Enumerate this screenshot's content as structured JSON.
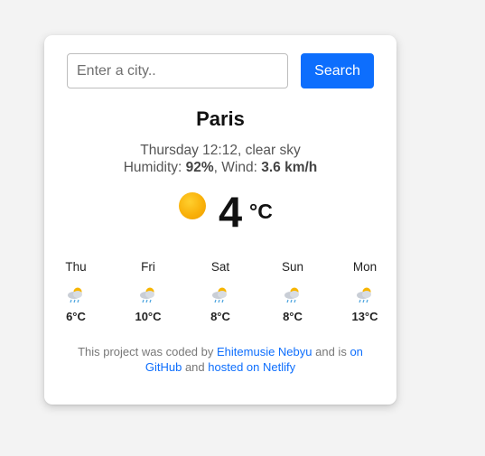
{
  "search": {
    "placeholder": "Enter a city..",
    "button_label": "Search"
  },
  "current": {
    "city": "Paris",
    "day_time": "Thursday 12:12",
    "description": "clear sky",
    "humidity_label": "Humidity:",
    "humidity_value": "92%",
    "wind_label": "Wind:",
    "wind_value": "3.6 km/h",
    "temperature": "4",
    "unit": "°C",
    "icon": "sun-icon"
  },
  "forecast": [
    {
      "day": "Thu",
      "temp": "6°C",
      "icon": "cloud-sun-rain-icon"
    },
    {
      "day": "Fri",
      "temp": "10°C",
      "icon": "cloud-sun-rain-icon"
    },
    {
      "day": "Sat",
      "temp": "8°C",
      "icon": "cloud-sun-rain-icon"
    },
    {
      "day": "Sun",
      "temp": "8°C",
      "icon": "cloud-sun-rain-icon"
    },
    {
      "day": "Mon",
      "temp": "13°C",
      "icon": "cloud-sun-rain-icon"
    }
  ],
  "footer": {
    "text_1": "This project was coded by",
    "author_link": "Ehitemusie Nebyu",
    "text_2": "and is",
    "github_link": "on GitHub",
    "text_3": "and",
    "netlify_link": "hosted on Netlify"
  },
  "colors": {
    "accent": "#0d6efd",
    "sun": "#f9b10a",
    "background": "#f3f3f3",
    "card": "#ffffff"
  }
}
